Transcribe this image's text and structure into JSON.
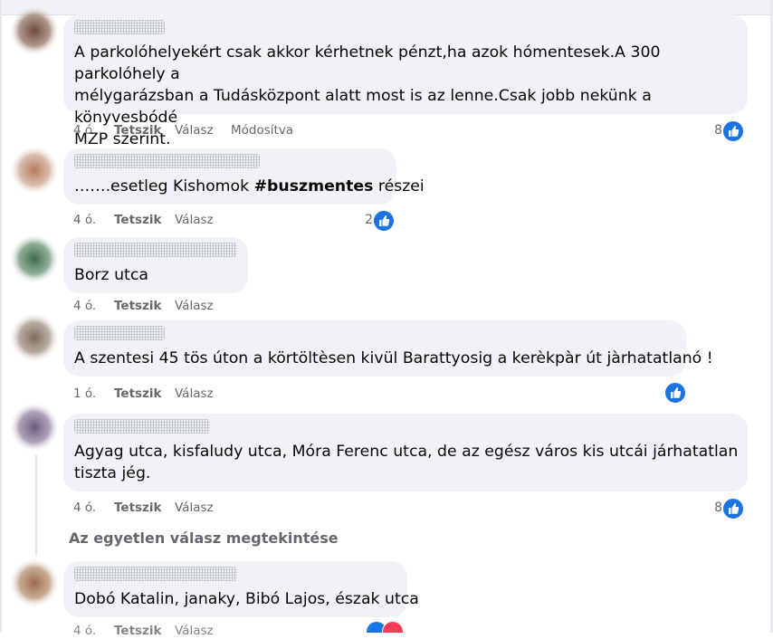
{
  "comments": [
    {
      "lines": [
        "A parkolóhelyekért csak akkor kérhetnek pénzt,ha azok hómentesek.A 300 parkolóhely a",
        "mélygarázsban a Tudásközpont alatt most is az lenne.Csak jobb nekünk a könyvesbódé",
        "MZP szerint."
      ],
      "time": "4 ó.",
      "like": "Tetszik",
      "reply": "Válasz",
      "edited": "Módosítva",
      "reactions": "8"
    },
    {
      "text_prefix": "…….esetleg Kishomok ",
      "hashtag": "#buszmentes",
      "text_suffix": " részei",
      "time": "4 ó.",
      "like": "Tetszik",
      "reply": "Válasz",
      "reactions": "2"
    },
    {
      "text": "Borz utca",
      "time": "4 ó.",
      "like": "Tetszik",
      "reply": "Válasz"
    },
    {
      "text": "A szentesi 45 tös úton a körtöltèsen kivül Barattyosig a kerèkpàr út jàrhatatlanó !",
      "time": "1 ó.",
      "like": "Tetszik",
      "reply": "Válasz",
      "reactions": ""
    },
    {
      "lines": [
        "Agyag utca, kisfaludy utca, Móra Ferenc utca, de az egész város kis utcái járhatatlan",
        "tiszta jég."
      ],
      "time": "4 ó.",
      "like": "Tetszik",
      "reply": "Válasz",
      "reactions": "8"
    },
    {
      "text": "Dobó Katalin, janaky, Bibó Lajos, észak utca",
      "time": "4 ó.",
      "like": "Tetszik",
      "reply": "Válasz"
    }
  ],
  "view_replies": "Az egyetlen válasz megtekintése",
  "colors": {
    "bubble": "#f0f2f5",
    "meta": "#65676b",
    "like_blue": "#1b74e4",
    "love_red": "#f33e58"
  },
  "icons": {
    "like": "thumbs-up-icon",
    "love": "heart-icon"
  }
}
